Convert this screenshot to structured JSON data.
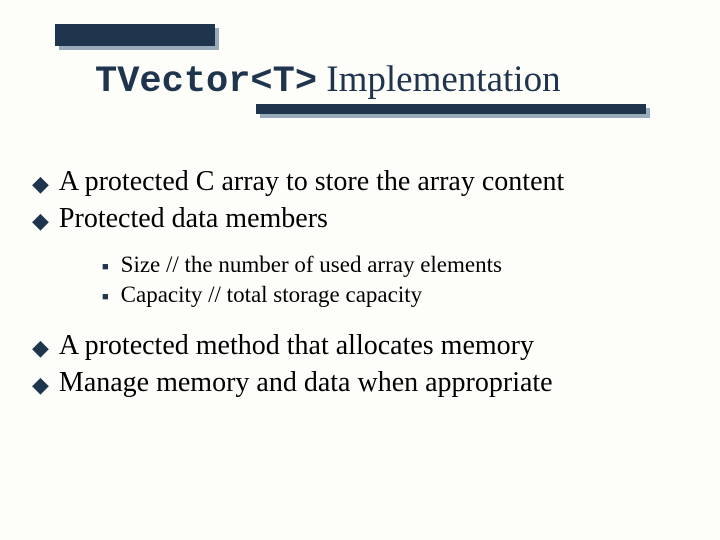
{
  "title": {
    "code": "TVector<T>",
    "rest": " Implementation"
  },
  "bullets": {
    "b1": "A protected C array to store the array content",
    "b2": "Protected data members",
    "s1": "Size // the number of used array elements",
    "s2": "Capacity // total storage capacity",
    "b3": "A protected method that allocates memory",
    "b4": "Manage memory and data when appropriate"
  }
}
